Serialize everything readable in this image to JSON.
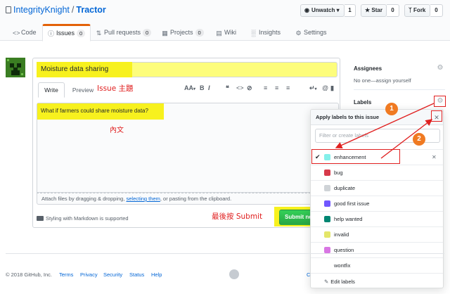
{
  "repo": {
    "owner": "IntegrityKnight",
    "separator": "/",
    "name": "Tractor"
  },
  "actions": {
    "watch_label": "Unwatch",
    "watch_count": "1",
    "star_label": "Star",
    "star_count": "0",
    "fork_label": "Fork",
    "fork_count": "0"
  },
  "tabs": [
    {
      "label": "Code",
      "icon": "code-icon"
    },
    {
      "label": "Issues",
      "count": "0",
      "icon": "issue-icon",
      "selected": true
    },
    {
      "label": "Pull requests",
      "count": "0",
      "icon": "pull-request-icon"
    },
    {
      "label": "Projects",
      "count": "0",
      "icon": "project-icon"
    },
    {
      "label": "Wiki",
      "icon": "book-icon"
    },
    {
      "label": "Insights",
      "icon": "graph-icon"
    },
    {
      "label": "Settings",
      "icon": "gear-icon"
    }
  ],
  "editor": {
    "title_value": "Moisture data sharing",
    "write_tab": "Write",
    "preview_tab": "Preview",
    "toolbar": {
      "heading": "AA",
      "bold": "B",
      "italic": "I",
      "quote": "❝",
      "code": "<>",
      "link": "⊘"
    },
    "body_text": "What if farmers could share moisture data?",
    "attach_prefix": "Attach files by dragging & dropping, ",
    "attach_link": "selecting them",
    "attach_suffix": ", or pasting from the clipboard.",
    "markdown_note": "Styling with Markdown is supported",
    "submit_label": "Submit new issue"
  },
  "annotations": {
    "issue_title": "Issue 主題",
    "body": "內文",
    "submit": "最後按 Submit",
    "badge_1": "1",
    "badge_2": "2",
    "color": "#e02020"
  },
  "sidebar": {
    "assignees_heading": "Assignees",
    "assignees_text": "No one—assign yourself",
    "labels_heading": "Labels"
  },
  "label_popup": {
    "title": "Apply labels to this issue",
    "filter_placeholder": "Filter or create labels",
    "labels": [
      {
        "name": "enhancement",
        "color": "#84b6eb",
        "selected": true
      },
      {
        "name": "bug",
        "color": "#ee0701"
      },
      {
        "name": "duplicate",
        "color": "#cccccc"
      },
      {
        "name": "good first issue",
        "color": "#7057ff"
      },
      {
        "name": "help wanted",
        "color": "#008672"
      },
      {
        "name": "invalid",
        "color": "#e4e669"
      },
      {
        "name": "question",
        "color": "#d876e3"
      },
      {
        "name": "wontfix",
        "color": "#ffffff"
      }
    ],
    "edit_labels": "Edit labels"
  },
  "footer": {
    "copyright": "© 2018 GitHub, Inc.",
    "links": [
      "Terms",
      "Privacy",
      "Security",
      "Status",
      "Help"
    ],
    "right_fragment": "C"
  }
}
